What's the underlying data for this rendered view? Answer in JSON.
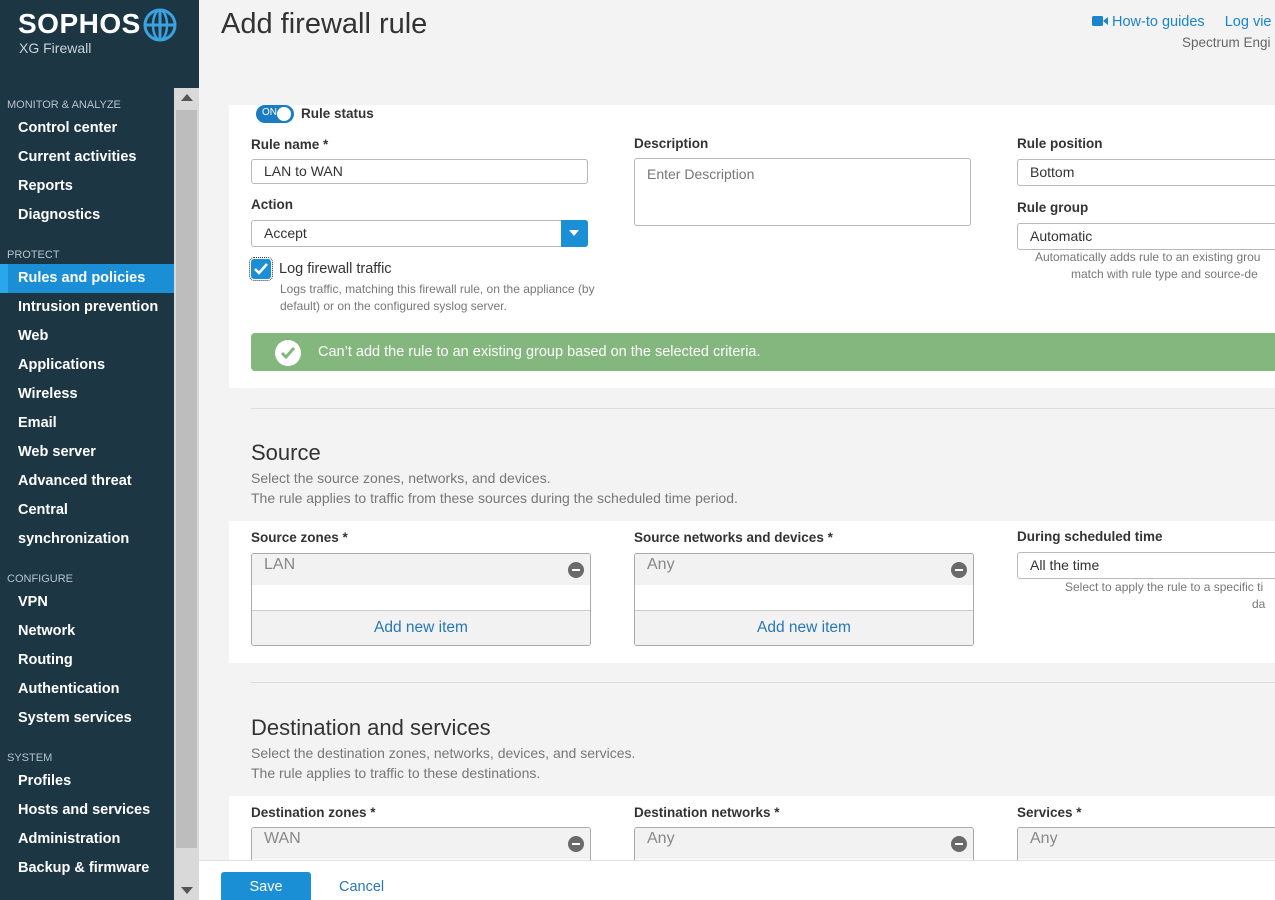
{
  "brand": {
    "name": "SOPHOS",
    "product": "XG Firewall"
  },
  "sidebar": {
    "sections": [
      {
        "title": "MONITOR & ANALYZE",
        "items": [
          "Control center",
          "Current activities",
          "Reports",
          "Diagnostics"
        ]
      },
      {
        "title": "PROTECT",
        "items": [
          "Rules and policies",
          "Intrusion prevention",
          "Web",
          "Applications",
          "Wireless",
          "Email",
          "Web server",
          "Advanced threat",
          "Central",
          "synchronization"
        ]
      },
      {
        "title": "CONFIGURE",
        "items": [
          "VPN",
          "Network",
          "Routing",
          "Authentication",
          "System services"
        ]
      },
      {
        "title": "SYSTEM",
        "items": [
          "Profiles",
          "Hosts and services",
          "Administration",
          "Backup & firmware"
        ]
      }
    ],
    "active_item": "Rules and policies"
  },
  "header": {
    "title": "Add firewall rule",
    "how_to": "How-to guides",
    "log_view": "Log vie",
    "engine": "Spectrum Engi"
  },
  "rule": {
    "status_label": "Rule status",
    "toggle_text": "ON",
    "name_label": "Rule name *",
    "name_value": "LAN to WAN",
    "description_label": "Description",
    "description_placeholder": "Enter Description",
    "position_label": "Rule position",
    "position_value": "Bottom",
    "action_label": "Action",
    "action_value": "Accept",
    "group_label": "Rule group",
    "group_value": "Automatic",
    "group_hint_1": "Automatically adds rule to an existing grou",
    "group_hint_2": "match with rule type and source-de",
    "log_label": "Log firewall traffic",
    "log_hint_1": "Logs traffic, matching this firewall rule, on the appliance (by",
    "log_hint_2": "default) or on the configured syslog server.",
    "banner": "Can’t add the rule to an existing group based on the selected criteria."
  },
  "source": {
    "title": "Source",
    "desc_1": "Select the source zones, networks, and devices.",
    "desc_2": "The rule applies to traffic from these sources during the scheduled time period.",
    "zones_label": "Source zones *",
    "zones_item": "LAN",
    "networks_label": "Source networks and devices *",
    "networks_item": "Any",
    "add_new": "Add new item",
    "schedule_label": "During scheduled time",
    "schedule_value": "All the time",
    "schedule_hint_1": "Select to apply the rule to a specific ti",
    "schedule_hint_2": "da"
  },
  "destination": {
    "title": "Destination and services",
    "desc_1": "Select the destination zones, networks, devices, and services.",
    "desc_2": "The rule applies to traffic to these destinations.",
    "zones_label": "Destination zones *",
    "zones_item": "WAN",
    "networks_label": "Destination networks *",
    "networks_item": "Any",
    "services_label": "Services *",
    "services_item": "Any"
  },
  "footer": {
    "save": "Save",
    "cancel": "Cancel"
  },
  "colors": {
    "sidebar": "#1d3644",
    "accent": "#1b8fd5",
    "banner": "#84b77e"
  }
}
